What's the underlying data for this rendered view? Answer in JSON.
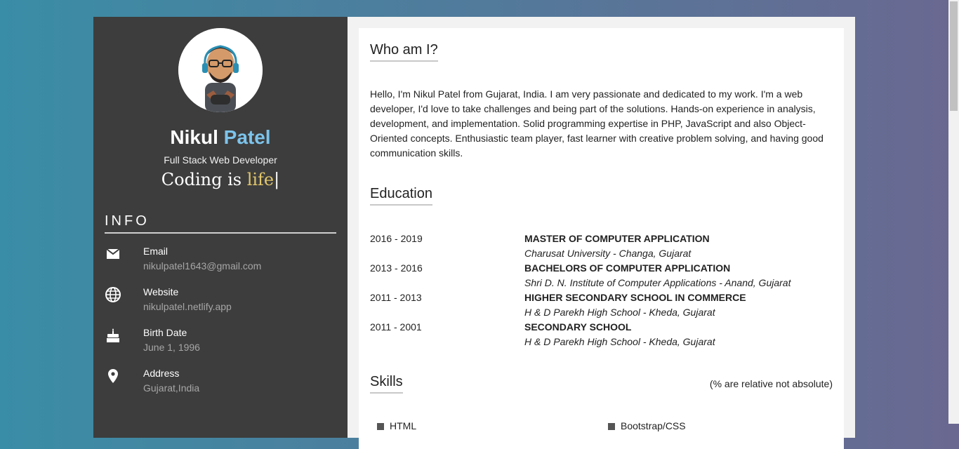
{
  "profile": {
    "first_name": "Nikul",
    "last_name": "Patel",
    "role": "Full Stack Web Developer",
    "typed_prefix": "Coding is ",
    "typed_word": "life",
    "cursor": "|"
  },
  "info": {
    "title": "INFO",
    "items": [
      {
        "icon": "email-icon",
        "label": "Email",
        "value": "nikulpatel1643@gmail.com"
      },
      {
        "icon": "globe-icon",
        "label": "Website",
        "value": "nikulpatel.netlify.app"
      },
      {
        "icon": "cake-icon",
        "label": "Birth Date",
        "value": "June 1, 1996"
      },
      {
        "icon": "location-pin-icon",
        "label": "Address",
        "value": "Gujarat,India"
      }
    ]
  },
  "about": {
    "title": "Who am I?",
    "text": "Hello, I'm Nikul Patel from Gujarat, India. I am very passionate and dedicated to my work. I'm a web developer, I'd love to take challenges and being part of the solutions. Hands-on experience in analysis, development, and implementation. Solid programming expertise in PHP, JavaScript and also Object-Oriented concepts. Enthusiastic team player, fast learner with creative problem solving, and having good communication skills."
  },
  "education": {
    "title": "Education",
    "rows": [
      {
        "years": "2016 - 2019",
        "degree": "MASTER OF COMPUTER APPLICATION",
        "school": "Charusat University - Changa, Gujarat"
      },
      {
        "years": "2013 - 2016",
        "degree": "BACHELORS OF COMPUTER APPLICATION",
        "school": "Shri D. N. Institute of Computer Applications - Anand, Gujarat"
      },
      {
        "years": "2011 - 2013",
        "degree": "HIGHER SECONDARY SCHOOL IN COMMERCE",
        "school": "H & D Parekh High School - Kheda, Gujarat"
      },
      {
        "years": "2011 - 2001",
        "degree": "SECONDARY SCHOOL",
        "school": "H & D Parekh High School - Kheda, Gujarat"
      }
    ]
  },
  "skills": {
    "title": "Skills",
    "note": "(% are relative not absolute)",
    "items": [
      "HTML",
      "Bootstrap/CSS"
    ]
  },
  "colors": {
    "accent": "#7cc4ec",
    "highlight": "#e2c76b",
    "sidebar": "#3d3d3d"
  }
}
